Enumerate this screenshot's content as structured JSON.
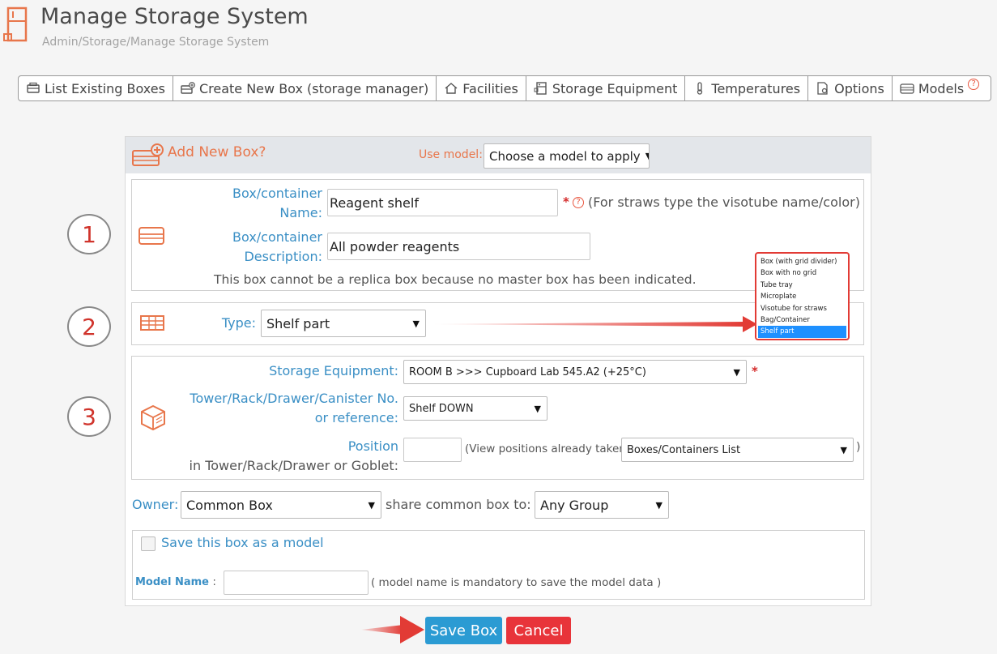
{
  "header": {
    "title": "Manage Storage System",
    "breadcrumb": "Admin/Storage/Manage Storage System"
  },
  "tabs": [
    {
      "label": "List Existing Boxes",
      "icon": "box-list-icon"
    },
    {
      "label": "Create New Box (storage manager)",
      "icon": "box-add-icon"
    },
    {
      "label": "Facilities",
      "icon": "home-icon"
    },
    {
      "label": "Storage Equipment",
      "icon": "freezer-icon"
    },
    {
      "label": "Temperatures",
      "icon": "thermometer-icon"
    },
    {
      "label": "Options",
      "icon": "document-gear-icon"
    },
    {
      "label": "Models",
      "icon": "models-icon"
    }
  ],
  "help_symbol": "?",
  "form": {
    "title": "Add New Box?",
    "use_model_label": "Use model:",
    "use_model_value": "Choose a model to apply",
    "name_label_line1": "Box/container",
    "name_label_line2": "Name:",
    "name_value": "Reagent shelf",
    "name_hint": "(For straws type the visotube name/color)",
    "desc_label_line1": "Box/container",
    "desc_label_line2": "Description:",
    "desc_value": "All powder reagents",
    "replica_note": "This box cannot be a replica box because no master box has been indicated.",
    "type_label": "Type:",
    "type_value": "Shelf part",
    "type_options": [
      "Box (with grid divider)",
      "Box with no grid",
      "Tube tray",
      "Microplate",
      "Visotube for straws",
      "Bag/Container",
      "Shelf part"
    ],
    "equipment_label": "Storage Equipment:",
    "equipment_value": "ROOM B >>> Cupboard Lab 545.A2 (+25°C)",
    "tower_label_line1": "Tower/Rack/Drawer/Canister No.",
    "tower_label_line2": "or reference:",
    "tower_value": "Shelf DOWN",
    "position_label_line1": "Position",
    "position_label_line2": "in Tower/Rack/Drawer or Goblet:",
    "position_value": "",
    "positions_hint": "(View positions already taken:",
    "positions_list_value": "Boxes/Containers List",
    "positions_close": ")",
    "owner_label": "Owner:",
    "owner_value": "Common Box",
    "share_label": "share common box to:",
    "share_value": "Any Group",
    "save_model_label": "Save this box as a model",
    "model_name_label": "Model Name",
    "model_name_colon": ":",
    "model_name_value": "",
    "model_name_hint": "( model name is mandatory to save the model data )",
    "required_mark": "*"
  },
  "steps": [
    "1",
    "2",
    "3"
  ],
  "buttons": {
    "save": "Save Box",
    "cancel": "Cancel"
  },
  "colors": {
    "accent_orange": "#e8764b",
    "label_blue": "#3a8fc5",
    "save_blue": "#2b9bd3",
    "cancel_red": "#e8343a",
    "annotation_red": "#d0342c"
  }
}
